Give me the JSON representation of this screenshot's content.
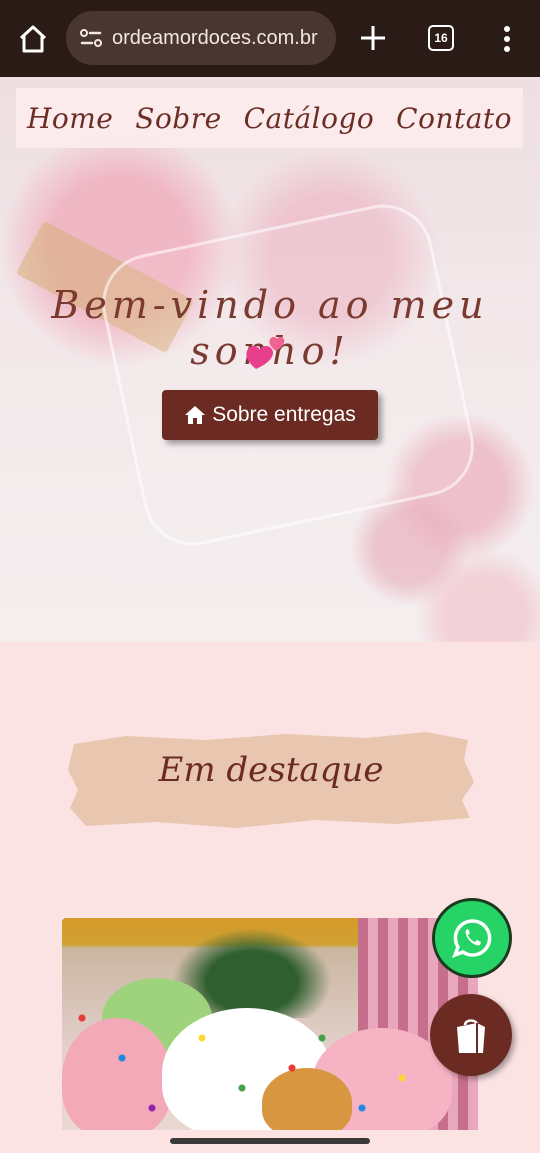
{
  "browser": {
    "url": "ordeamordoces.com.br",
    "tab_count": "16",
    "icons": [
      "home-icon",
      "site-settings-icon",
      "new-tab-plus-icon",
      "tab-switcher-icon",
      "more-menu-icon"
    ]
  },
  "nav": {
    "items": [
      "Home",
      "Sobre",
      "Catálogo",
      "Contato"
    ]
  },
  "hero": {
    "title": "Bem-vindo ao meu sonho!",
    "emoji": "two-hearts-icon",
    "button_label": "Sobre entregas",
    "button_icon": "house-icon"
  },
  "featured": {
    "title": "Em destaque"
  },
  "floating": {
    "whatsapp_icon": "whatsapp-icon",
    "shop_icon": "shopping-bag-icon"
  },
  "colors": {
    "brand_brown": "#6b2b22",
    "page_pink": "#fbe3e3",
    "brush_beige": "#e8c6b0",
    "whatsapp_green": "#25d366"
  }
}
